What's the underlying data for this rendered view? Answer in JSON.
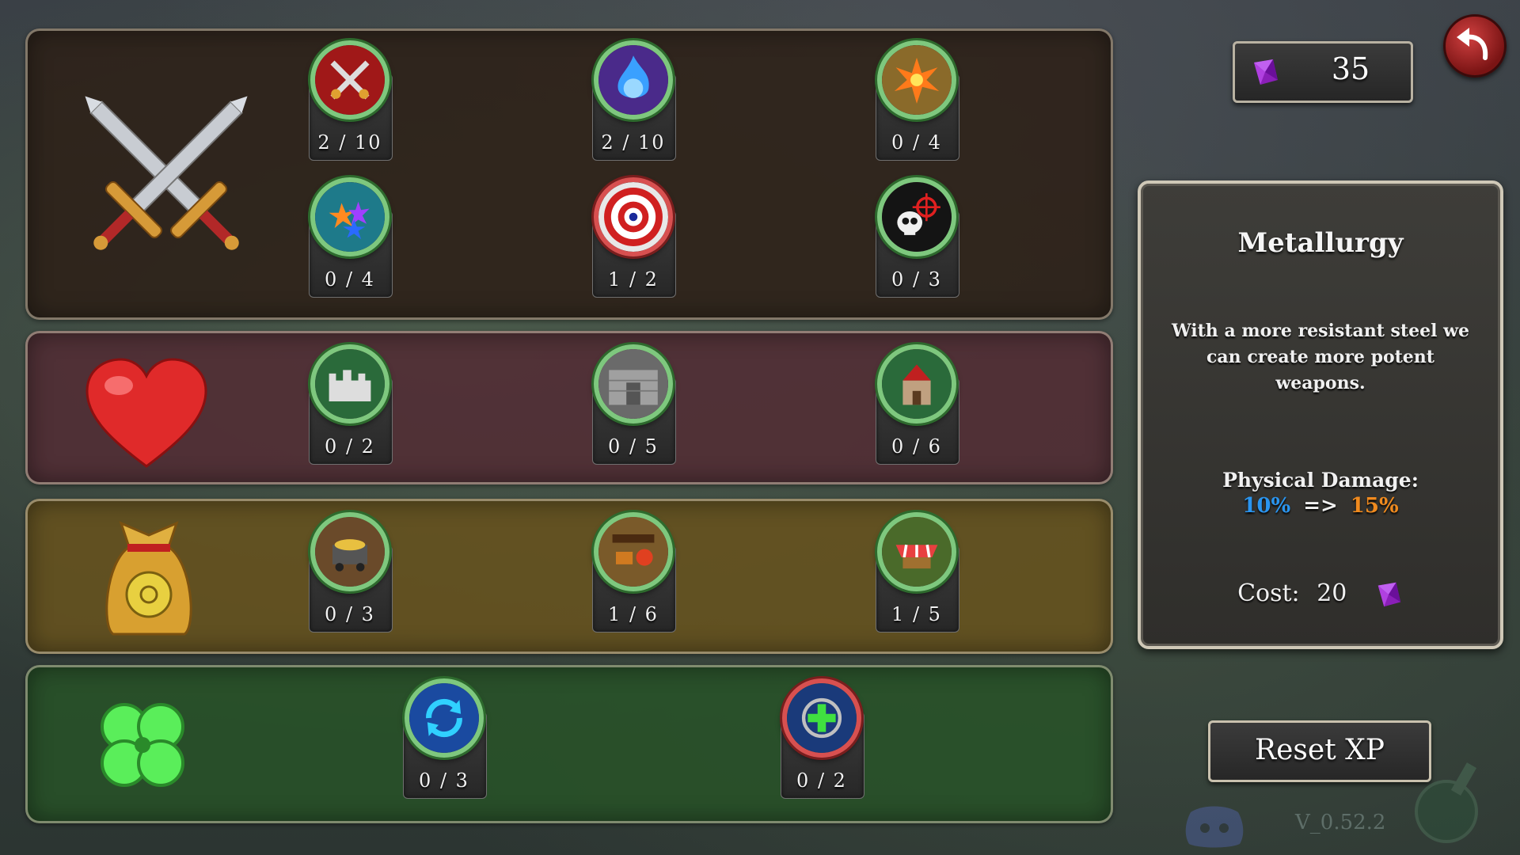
{
  "currency": {
    "gems": "35"
  },
  "categories": {
    "attack": {
      "icon": "crossed-swords-icon",
      "upgrades": [
        {
          "icon": "crossed-swords-badge-icon",
          "progress": "2 / 10"
        },
        {
          "icon": "blue-flame-orb-icon",
          "progress": "2 / 10"
        },
        {
          "icon": "explosion-burst-icon",
          "progress": "0 / 4"
        },
        {
          "icon": "magic-sparks-icon",
          "progress": "0 / 4"
        },
        {
          "icon": "bullseye-target-icon",
          "progress": "1 / 2"
        },
        {
          "icon": "skull-crosshair-icon",
          "progress": "0 / 3"
        }
      ]
    },
    "health": {
      "icon": "heart-icon",
      "upgrades": [
        {
          "icon": "stone-wall-icon",
          "progress": "0 / 2"
        },
        {
          "icon": "castle-gate-icon",
          "progress": "0 / 5"
        },
        {
          "icon": "castle-tower-icon",
          "progress": "0 / 6"
        }
      ]
    },
    "gold": {
      "icon": "gold-bag-icon",
      "upgrades": [
        {
          "icon": "mine-cart-icon",
          "progress": "0 / 3"
        },
        {
          "icon": "workshop-icon",
          "progress": "1 / 6"
        },
        {
          "icon": "market-stall-icon",
          "progress": "1 / 5"
        }
      ]
    },
    "luck": {
      "icon": "four-leaf-clover-icon",
      "upgrades": [
        {
          "icon": "refresh-cycle-icon",
          "progress": "0 / 3"
        },
        {
          "icon": "green-cross-icon",
          "progress": "0 / 2"
        }
      ]
    }
  },
  "info": {
    "title": "Metallurgy",
    "description": "With a more resistant steel we can create more potent weapons.",
    "stat_label": "Physical Damage:",
    "stat_from": "10%",
    "stat_arrow": "=>",
    "stat_to": "15%",
    "cost_label": "Cost:",
    "cost_value": "20"
  },
  "buttons": {
    "reset": "Reset XP"
  },
  "version": "V_0.52.2",
  "colors": {
    "stat_from": "#2a95f0",
    "stat_to": "#f08a1e",
    "gem": "#a020c8"
  }
}
